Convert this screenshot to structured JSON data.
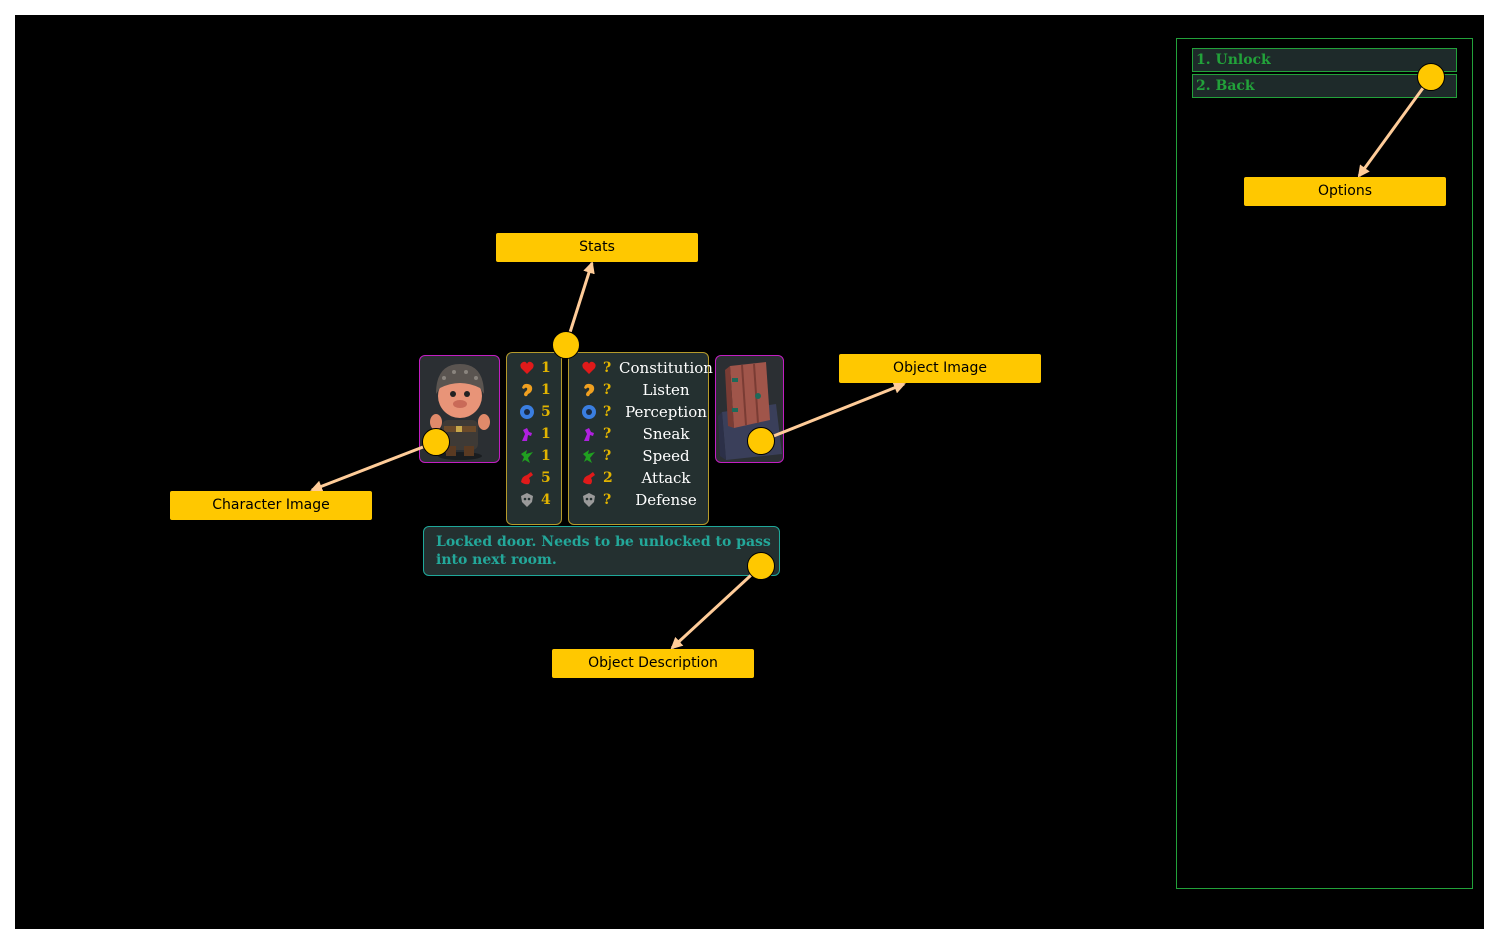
{
  "stats": {
    "rows": [
      {
        "icon": "heart-icon",
        "player_value": "1",
        "object_value": "?",
        "name": "Constitution",
        "color": "#e01a1a"
      },
      {
        "icon": "ear-icon",
        "player_value": "1",
        "object_value": "?",
        "name": "Listen",
        "color": "#f0a020"
      },
      {
        "icon": "eye-icon",
        "player_value": "5",
        "object_value": "?",
        "name": "Perception",
        "color": "#3a7ee0"
      },
      {
        "icon": "sneak-icon",
        "player_value": "1",
        "object_value": "?",
        "name": "Sneak",
        "color": "#b020e0"
      },
      {
        "icon": "speed-icon",
        "player_value": "1",
        "object_value": "?",
        "name": "Speed",
        "color": "#20a020"
      },
      {
        "icon": "attack-icon",
        "player_value": "5",
        "object_value": "2",
        "name": "Attack",
        "color": "#e01a1a"
      },
      {
        "icon": "defense-icon",
        "player_value": "4",
        "object_value": "?",
        "name": "Defense",
        "color": "#9a9a9a"
      }
    ]
  },
  "object": {
    "description": "Locked door. Needs to be unlocked to pass into next room."
  },
  "options": {
    "items": [
      "1. Unlock",
      "2. Back"
    ]
  },
  "annotations": {
    "stats": "Stats",
    "options": "Options",
    "object_image": "Object Image",
    "character_image": "Character Image",
    "object_description": "Object Description"
  },
  "colors": {
    "annotation": "#ffc800",
    "arrow": "#ffcc99",
    "options_green": "#22a23a",
    "description_teal": "#23a89a",
    "stat_value": "#e2b400"
  }
}
